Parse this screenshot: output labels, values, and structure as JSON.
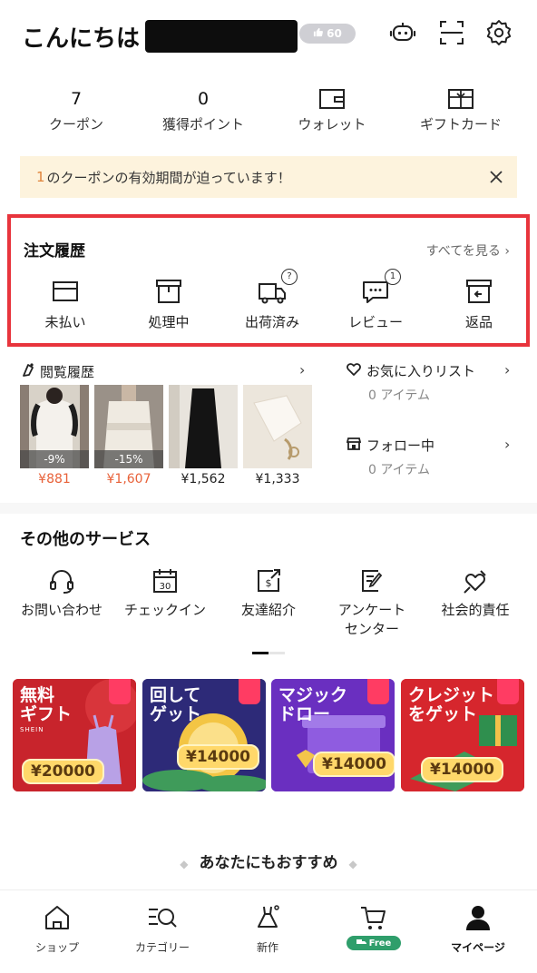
{
  "header": {
    "greeting": "こんにちは",
    "level_badge": "60",
    "icons": [
      "support-robot-icon",
      "scan-icon",
      "settings-gear-icon"
    ]
  },
  "stats": [
    {
      "value": "7",
      "label": "クーポン"
    },
    {
      "value": "0",
      "label": "獲得ポイント"
    },
    {
      "icon": "wallet-icon",
      "label": "ウォレット"
    },
    {
      "icon": "gift-card-icon",
      "label": "ギフトカード"
    }
  ],
  "notice": {
    "count": "1",
    "text": "のクーポンの有効期間が迫っています！"
  },
  "orders": {
    "title": "注文履歴",
    "see_all": "すべてを見る",
    "items": [
      {
        "icon": "wallet-card-icon",
        "label": "未払い",
        "badge": ""
      },
      {
        "icon": "box-icon",
        "label": "処理中",
        "badge": ""
      },
      {
        "icon": "truck-icon",
        "label": "出荷済み",
        "badge": "?"
      },
      {
        "icon": "review-bubble-icon",
        "label": "レビュー",
        "badge": "1"
      },
      {
        "icon": "return-box-icon",
        "label": "返品",
        "badge": ""
      }
    ]
  },
  "history": {
    "title": "閲覧履歴",
    "products": [
      {
        "discount": "-9%",
        "price": "¥881",
        "sale": true,
        "colors": [
          "#6b5f57",
          "#f2efe9"
        ]
      },
      {
        "discount": "-15%",
        "price": "¥1,607",
        "sale": true,
        "colors": [
          "#8a7f76",
          "#ebe6dc"
        ]
      },
      {
        "discount": "",
        "price": "¥1,562",
        "sale": false,
        "colors": [
          "#e5e0d8",
          "#1a1a1a"
        ]
      },
      {
        "discount": "",
        "price": "¥1,333",
        "sale": false,
        "colors": [
          "#e9e2d7",
          "#f7f4ef"
        ]
      }
    ]
  },
  "side_lists": {
    "wishlist_title": "お気に入りリスト",
    "wishlist_count": "0 アイテム",
    "following_title": "フォロー中",
    "following_count": "0 アイテム"
  },
  "services": {
    "title": "その他のサービス",
    "items": [
      {
        "icon": "headset-icon",
        "label": "お問い合わせ"
      },
      {
        "icon": "calendar-30-icon",
        "label": "チェックイン"
      },
      {
        "icon": "share-dollar-icon",
        "label": "友達紹介"
      },
      {
        "icon": "survey-pencil-icon",
        "label": "アンケート\nセンター"
      },
      {
        "icon": "heart-hand-icon",
        "label": "社会的責任"
      }
    ]
  },
  "promos": [
    {
      "title": "無料\nギフト",
      "sub": "SHEIN",
      "amount": "¥20000",
      "bg": "#c8242c"
    },
    {
      "title": "回して\nゲット",
      "amount": "¥14000",
      "bg": "#2d2a78"
    },
    {
      "title": "マジック\nドロー",
      "amount": "¥14000",
      "bg": "#6a2fc0"
    },
    {
      "title": "クレジット\nをゲット",
      "amount": "¥14000",
      "bg": "#d6262d"
    }
  ],
  "recommend": "あなたにもおすすめ",
  "tabs": [
    {
      "icon": "home-shop-icon",
      "label": "ショップ"
    },
    {
      "icon": "category-search-icon",
      "label": "カテゴリー"
    },
    {
      "icon": "dress-new-icon",
      "label": "新作"
    },
    {
      "icon": "cart-icon",
      "label": "",
      "badge": "Free"
    },
    {
      "icon": "person-icon",
      "label": "マイページ",
      "active": true
    }
  ]
}
